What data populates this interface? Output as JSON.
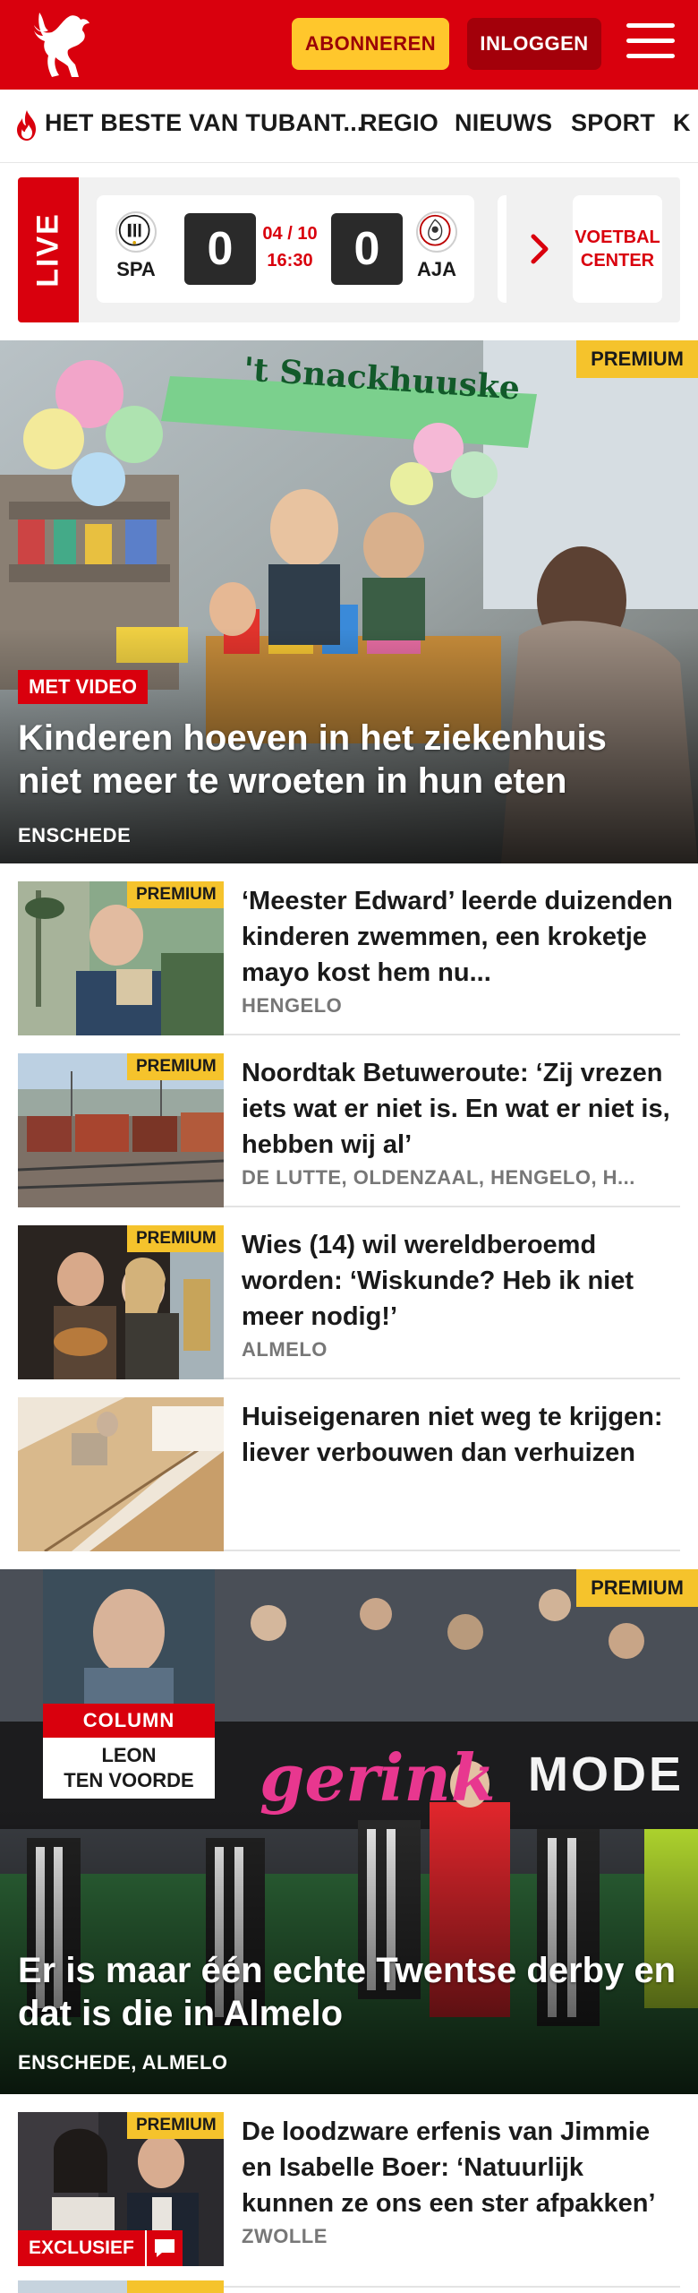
{
  "header": {
    "subscribe_label": "ABONNEREN",
    "login_label": "INLOGGEN"
  },
  "nav": {
    "items": [
      "HET BESTE VAN TUBANT...",
      "REGIO",
      "NIEUWS",
      "SPORT",
      "K"
    ]
  },
  "live": {
    "tag": "LIVE",
    "home_team": "SPA",
    "away_team": "AJA",
    "home_score": "0",
    "away_score": "0",
    "date": "04 / 10",
    "time": "16:30",
    "voetbal_line1": "VOETBAL",
    "voetbal_line2": "CENTER"
  },
  "hero1": {
    "premium": "PREMIUM",
    "badge": "MET VIDEO",
    "title": "Kinderen hoeven in het ziekenhuis niet meer te wroeten in hun eten",
    "location": "ENSCHEDE",
    "sign_text": "'t Snackhuuske"
  },
  "articles": [
    {
      "premium": "PREMIUM",
      "title": "‘Meester Edward’ leerde duizenden kinderen zwemmen, een kroketje mayo kost hem nu...",
      "location": "HENGELO"
    },
    {
      "premium": "PREMIUM",
      "title": "Noordtak Betuweroute: ‘Zij vrezen iets wat er niet is. En wat er niet is, hebben wij al’",
      "location": "DE LUTTE, OLDENZAAL, HENGELO, H..."
    },
    {
      "premium": "PREMIUM",
      "title": "Wies (14) wil wereldberoemd worden: ‘Wiskunde? Heb ik niet meer nodig!’",
      "location": "ALMELO"
    },
    {
      "premium": "",
      "title": "Huiseigenaren niet weg te krijgen: liever verbouwen dan verhuizen",
      "location": ""
    }
  ],
  "hero2": {
    "premium": "PREMIUM",
    "column_label": "COLUMN",
    "author_line1": "LEON",
    "author_line2": "TEN VOORDE",
    "title": "Er is maar één echte Twentse derby en dat is die in Almelo",
    "location": "ENSCHEDE, ALMELO",
    "ad_text1": "gerink",
    "ad_text2": "MODE"
  },
  "article5": {
    "premium": "PREMIUM",
    "badge": "EXCLUSIEF",
    "title": "De loodzware erfenis van Jimmie en Isabelle Boer: ‘Natuurlijk kunnen ze ons een ster afpakken’",
    "location": "ZWOLLE"
  },
  "article6": {
    "premium": "PREMIUM"
  },
  "colors": {
    "brand_red": "#d9000d",
    "premium_yellow": "#f5c32c",
    "subscribe_yellow": "#ffc72c"
  }
}
